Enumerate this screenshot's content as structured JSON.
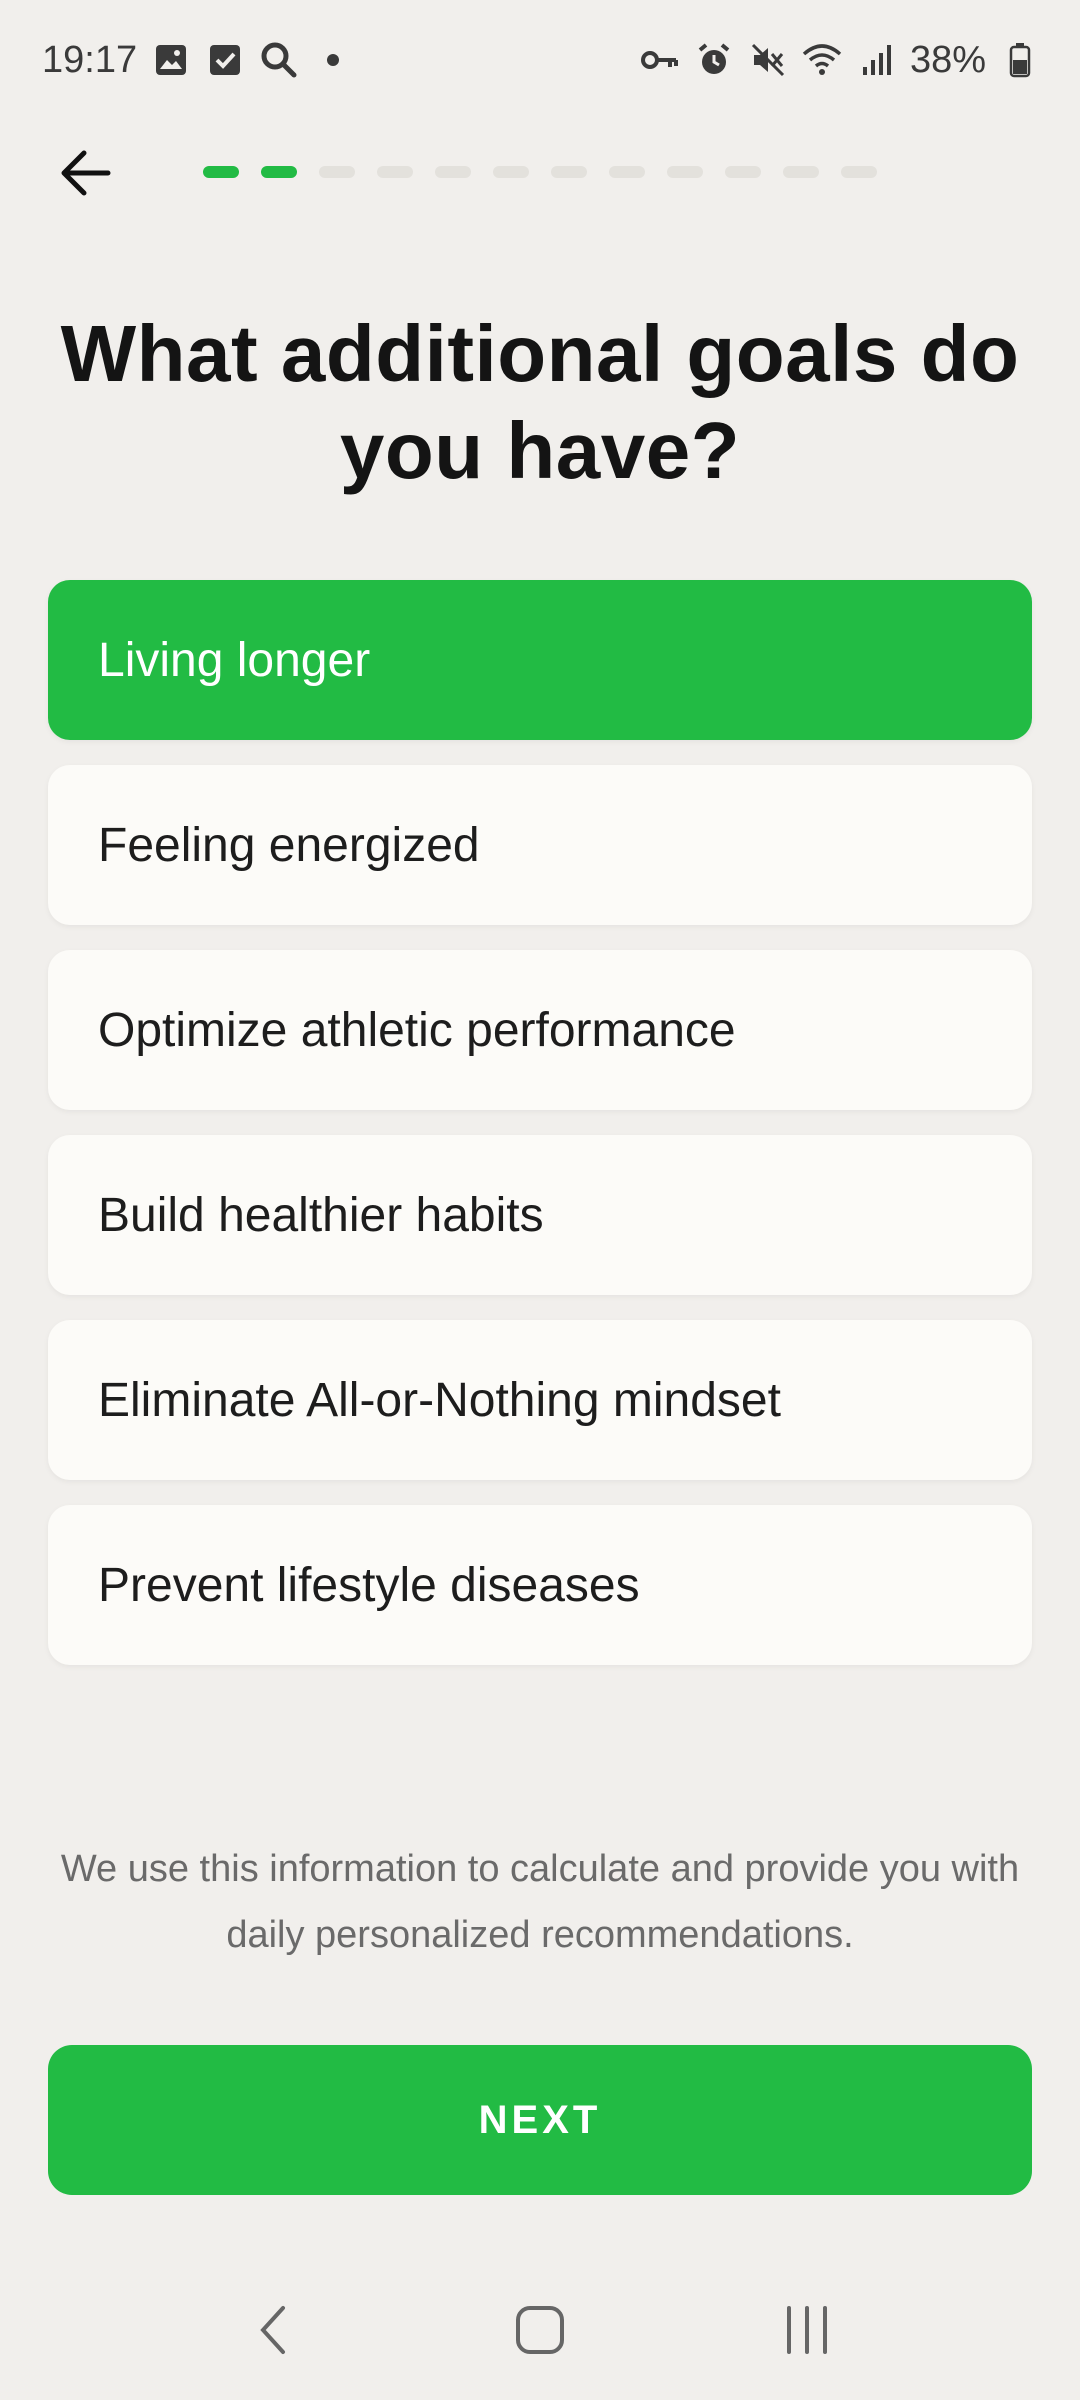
{
  "status_bar": {
    "time": "19:17",
    "left_icons": [
      "image-icon",
      "checkbox-icon",
      "search-icon"
    ],
    "right_icons": [
      "key-icon",
      "alarm-icon",
      "mute-icon",
      "wifi-icon",
      "signal-icon"
    ],
    "battery": "38%"
  },
  "header": {
    "progress": {
      "current": 2,
      "total": 12
    }
  },
  "title": "What additional goals do you have?",
  "options": [
    {
      "label": "Living longer",
      "selected": true
    },
    {
      "label": "Feeling energized",
      "selected": false
    },
    {
      "label": "Optimize athletic performance",
      "selected": false
    },
    {
      "label": "Build healthier habits",
      "selected": false
    },
    {
      "label": "Eliminate All-or-Nothing mindset",
      "selected": false
    },
    {
      "label": "Prevent lifestyle diseases",
      "selected": false
    }
  ],
  "info_text": "We use this information to calculate and provide you with daily personalized recommendations.",
  "next_button": "NEXT",
  "colors": {
    "accent": "#22bb44",
    "background": "#f1efec",
    "card": "#fcfbf8",
    "progress_inactive": "#e3e1dc"
  }
}
